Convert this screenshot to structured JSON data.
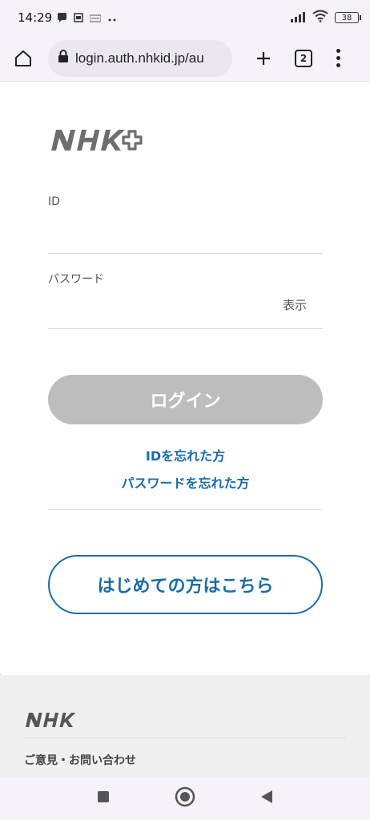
{
  "status_bar": {
    "time": "14:29",
    "battery": "38",
    "icons": [
      "chat-notification-icon",
      "photo-icon",
      "news-icon",
      "more-dots-icon",
      "signal-icon",
      "wifi-icon",
      "battery-icon"
    ]
  },
  "browser": {
    "url": "login.auth.nhkid.jp/au",
    "tab_count": "2",
    "icons": [
      "home-icon",
      "lock-icon",
      "plus-icon",
      "tabs-icon",
      "kebab-menu-icon"
    ]
  },
  "form": {
    "id_label": "ID",
    "id_value": "",
    "password_label": "パスワード",
    "password_value": "",
    "show_label": "表示",
    "login_label": "ログイン",
    "forgot_id": "IDを忘れた方",
    "forgot_password": "パスワードを忘れた方",
    "signup_label": "はじめての方はこちら"
  },
  "footer": {
    "contact_link": "ご意見・お問い合わせ"
  },
  "colors": {
    "accent": "#1b6ca8",
    "disabled_button": "#bdbdbd",
    "logo_gray": "#6e6e6e"
  }
}
